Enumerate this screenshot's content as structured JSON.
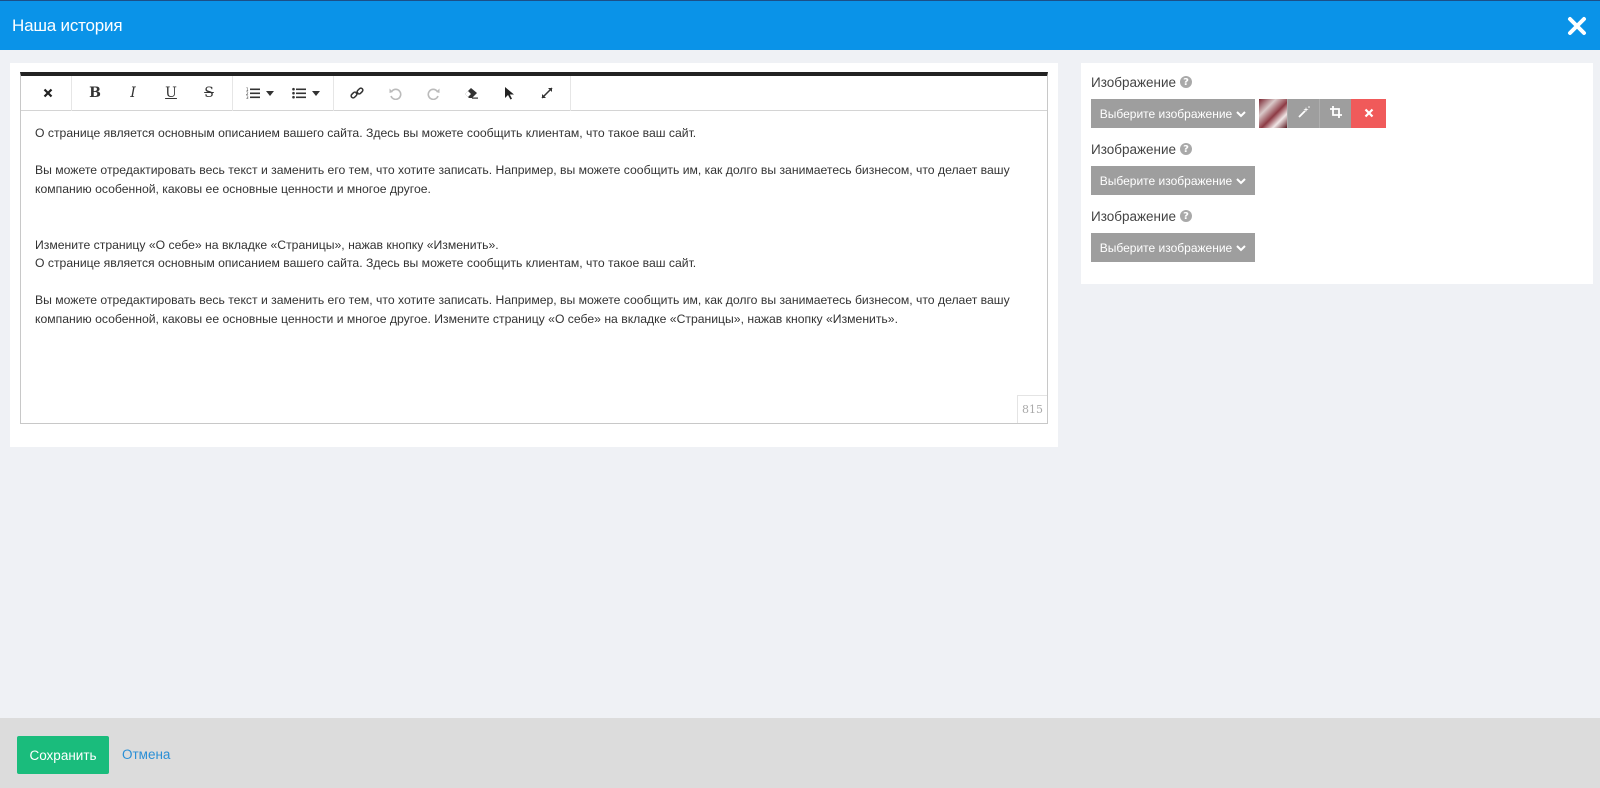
{
  "header": {
    "title": "Наша история"
  },
  "editor": {
    "paragraphs": [
      "О странице является основным описанием вашего сайта. Здесь вы можете сообщить клиентам, что такое ваш сайт.",
      "",
      "Вы можете отредактировать весь текст и заменить его тем, что хотите записать. Например, вы можете сообщить им, как долго вы занимаетесь бизнесом, что делает вашу компанию особенной, каковы ее основные ценности и многое другое.",
      "",
      "",
      "Измените страницу «О себе» на вкладке «Страницы», нажав кнопку «Изменить».",
      "О странице является основным описанием вашего сайта. Здесь вы можете сообщить клиентам, что такое ваш сайт.",
      "",
      "Вы можете отредактировать весь текст и заменить его тем, что хотите записать. Например, вы можете сообщить им, как долго вы занимаетесь бизнесом, что делает вашу компанию особенной, каковы ее основные ценности и многое другое. Измените страницу «О себе» на вкладке «Страницы», нажав кнопку «Изменить»."
    ],
    "char_count": "815",
    "toolbar": [
      "close-icon",
      "bold-icon",
      "italic-icon",
      "underline-icon",
      "strikethrough-icon",
      "ordered-list-icon",
      "unordered-list-icon",
      "link-icon",
      "undo-icon",
      "redo-icon",
      "eraser-icon",
      "pointer-icon",
      "fullscreen-icon"
    ]
  },
  "images": {
    "fields": [
      {
        "label": "Изображение",
        "button": "Выберите изображение",
        "has_image": true
      },
      {
        "label": "Изображение",
        "button": "Выберите изображение",
        "has_image": false
      },
      {
        "label": "Изображение",
        "button": "Выберите изображение",
        "has_image": false
      }
    ]
  },
  "footer": {
    "save_label": "Сохранить",
    "cancel_label": "Отмена"
  },
  "colors": {
    "header": "#0a93e8",
    "save": "#1abc7c",
    "danger": "#f05a5a",
    "link": "#2a8fd6"
  }
}
